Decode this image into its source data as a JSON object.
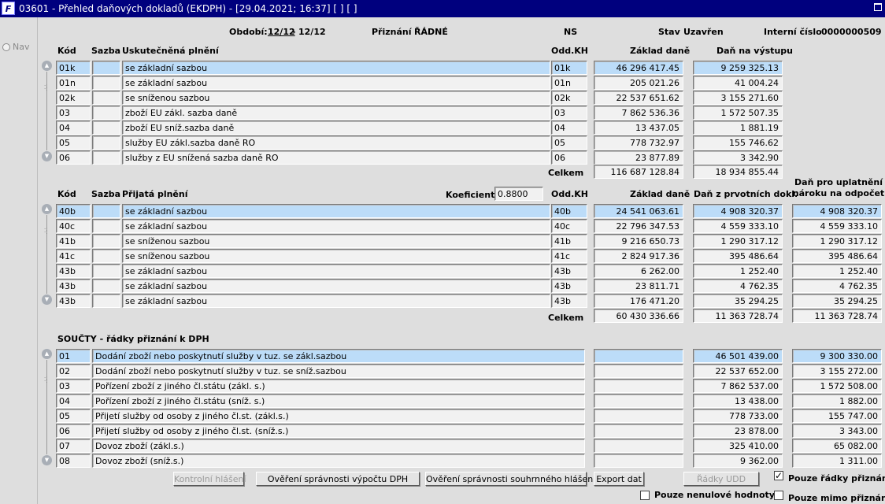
{
  "window": {
    "title": "03601 - Přehled daňových dokladů (EKDPH) - [29.04.2021; 16:37]  [ ]  [ ]"
  },
  "nav": {
    "label": "Nav"
  },
  "header": {
    "obdobi_label": "Období:",
    "obdobi_from": "12/12",
    "obdobi_sep": "-",
    "obdobi_to": "12/12",
    "priznani_label": "Přiznání",
    "priznani_value": "ŘÁDNÉ",
    "ns_label": "NS",
    "stav_label": "Stav",
    "stav_value": "Uzavřen",
    "interni_label": "Interní číslo",
    "interni_value": "0000000509"
  },
  "section1": {
    "col_kod": "Kód",
    "col_sazba": "Sazba",
    "col_desc": "Uskutečněná plnění",
    "col_odd": "Odd.KH",
    "col_zaklad": "Základ daně",
    "col_dan": "Daň na výstupu",
    "rows": [
      {
        "kod": "01k",
        "sazba": "",
        "desc": "se základní sazbou",
        "odd": "01k",
        "zaklad": "46 296 417.45",
        "dan": "9 259 325.13"
      },
      {
        "kod": "01n",
        "sazba": "",
        "desc": "se základní sazbou",
        "odd": "01n",
        "zaklad": "205 021.26",
        "dan": "41 004.24"
      },
      {
        "kod": "02k",
        "sazba": "",
        "desc": "se sníženou sazbou",
        "odd": "02k",
        "zaklad": "22 537 651.62",
        "dan": "3 155 271.60"
      },
      {
        "kod": "03",
        "sazba": "",
        "desc": "zboží EU zákl. sazba daně",
        "odd": "03",
        "zaklad": "7 862 536.36",
        "dan": "1 572 507.35"
      },
      {
        "kod": "04",
        "sazba": "",
        "desc": "zboží EU sníž.sazba daně",
        "odd": "04",
        "zaklad": "13 437.05",
        "dan": "1 881.19"
      },
      {
        "kod": "05",
        "sazba": "",
        "desc": "služby EU zákl.sazba daně RO",
        "odd": "05",
        "zaklad": "778 732.97",
        "dan": "155 746.62"
      },
      {
        "kod": "06",
        "sazba": "",
        "desc": "služby z EU snížená sazba daně RO",
        "odd": "06",
        "zaklad": "23 877.89",
        "dan": "3 342.90"
      }
    ],
    "celkem_label": "Celkem",
    "celkem_zaklad": "116 687 128.84",
    "celkem_dan": "18 934 855.44"
  },
  "section2": {
    "col_kod": "Kód",
    "col_sazba": "Sazba",
    "col_desc": "Přijatá plnění",
    "koef_label": "Koeficient",
    "koef_value": "0.8800",
    "col_odd": "Odd.KH",
    "col_zaklad": "Základ daně",
    "col_dan": "Daň z prvotních dokl.",
    "col_narok_1": "Daň pro uplatnění",
    "col_narok_2": "nároku na odpočet",
    "rows": [
      {
        "kod": "40b",
        "sazba": "",
        "desc": "se základní sazbou",
        "odd": "40b",
        "zaklad": "24 541 063.61",
        "dan": "4 908 320.37",
        "narok": "4 908 320.37"
      },
      {
        "kod": "40c",
        "sazba": "",
        "desc": "se základní sazbou",
        "odd": "40c",
        "zaklad": "22 796 347.53",
        "dan": "4 559 333.10",
        "narok": "4 559 333.10"
      },
      {
        "kod": "41b",
        "sazba": "",
        "desc": "se sníženou sazbou",
        "odd": "41b",
        "zaklad": "9 216 650.73",
        "dan": "1 290 317.12",
        "narok": "1 290 317.12"
      },
      {
        "kod": "41c",
        "sazba": "",
        "desc": "se sníženou sazbou",
        "odd": "41c",
        "zaklad": "2 824 917.36",
        "dan": "395 486.64",
        "narok": "395 486.64"
      },
      {
        "kod": "43b",
        "sazba": "",
        "desc": "se základní sazbou",
        "odd": "43b",
        "zaklad": "6 262.00",
        "dan": "1 252.40",
        "narok": "1 252.40"
      },
      {
        "kod": "43b",
        "sazba": "",
        "desc": "se základní sazbou",
        "odd": "43b",
        "zaklad": "23 811.71",
        "dan": "4 762.35",
        "narok": "4 762.35"
      },
      {
        "kod": "43b",
        "sazba": "",
        "desc": "se základní sazbou",
        "odd": "43b",
        "zaklad": "176 471.20",
        "dan": "35 294.25",
        "narok": "35 294.25"
      }
    ],
    "celkem_label": "Celkem",
    "celkem_zaklad": "60 430 336.66",
    "celkem_dan": "11 363 728.74",
    "celkem_narok": "11 363 728.74"
  },
  "section3": {
    "title": "SOUČTY - řádky přiznání k DPH",
    "rows": [
      {
        "kod": "01",
        "desc": "Dodání zboží nebo poskytnutí služby v tuz. se zákl.sazbou",
        "blank": "",
        "zaklad": "46 501 439.00",
        "dan": "9 300 330.00"
      },
      {
        "kod": "02",
        "desc": "Dodání zboží nebo poskytnutí služby v tuz. se sníž.sazbou",
        "blank": "",
        "zaklad": "22 537 652.00",
        "dan": "3 155 272.00"
      },
      {
        "kod": "03",
        "desc": "Pořízení zboží z jiného čl.státu (zákl. s.)",
        "blank": "",
        "zaklad": "7 862 537.00",
        "dan": "1 572 508.00"
      },
      {
        "kod": "04",
        "desc": "Pořízení zboží z jiného čl.státu (sníž. s.)",
        "blank": "",
        "zaklad": "13 438.00",
        "dan": "1 882.00"
      },
      {
        "kod": "05",
        "desc": "Přijetí služby od osoby z jiného čl.st. (zákl.s.)",
        "blank": "",
        "zaklad": "778 733.00",
        "dan": "155 747.00"
      },
      {
        "kod": "06",
        "desc": "Přijetí služby od osoby z jiného čl.st. (sníž.s.)",
        "blank": "",
        "zaklad": "23 878.00",
        "dan": "3 343.00"
      },
      {
        "kod": "07",
        "desc": "Dovoz zboží (zákl.s.)",
        "blank": "",
        "zaklad": "325 410.00",
        "dan": "65 082.00"
      },
      {
        "kod": "08",
        "desc": "Dovoz zboží (sníž.s.)",
        "blank": "",
        "zaklad": "9 362.00",
        "dan": "1 311.00"
      }
    ]
  },
  "buttons": {
    "kontrolni": "Kontrolní hlášení",
    "overeni_dph": "Ověření správnosti výpočtu DPH",
    "overeni_souhrn": "Ověření správnosti souhrnného hlášení",
    "export": "Export dat",
    "radky_udd": "Řádky UDD"
  },
  "checkboxes": {
    "pouze_radky": {
      "label": "Pouze řádky přiznání",
      "checked": true
    },
    "pouze_nenulove": {
      "label": "Pouze nenulové hodnoty",
      "checked": false
    },
    "pouze_mimo": {
      "label": "Pouze mimo přiznání",
      "checked": false
    }
  }
}
